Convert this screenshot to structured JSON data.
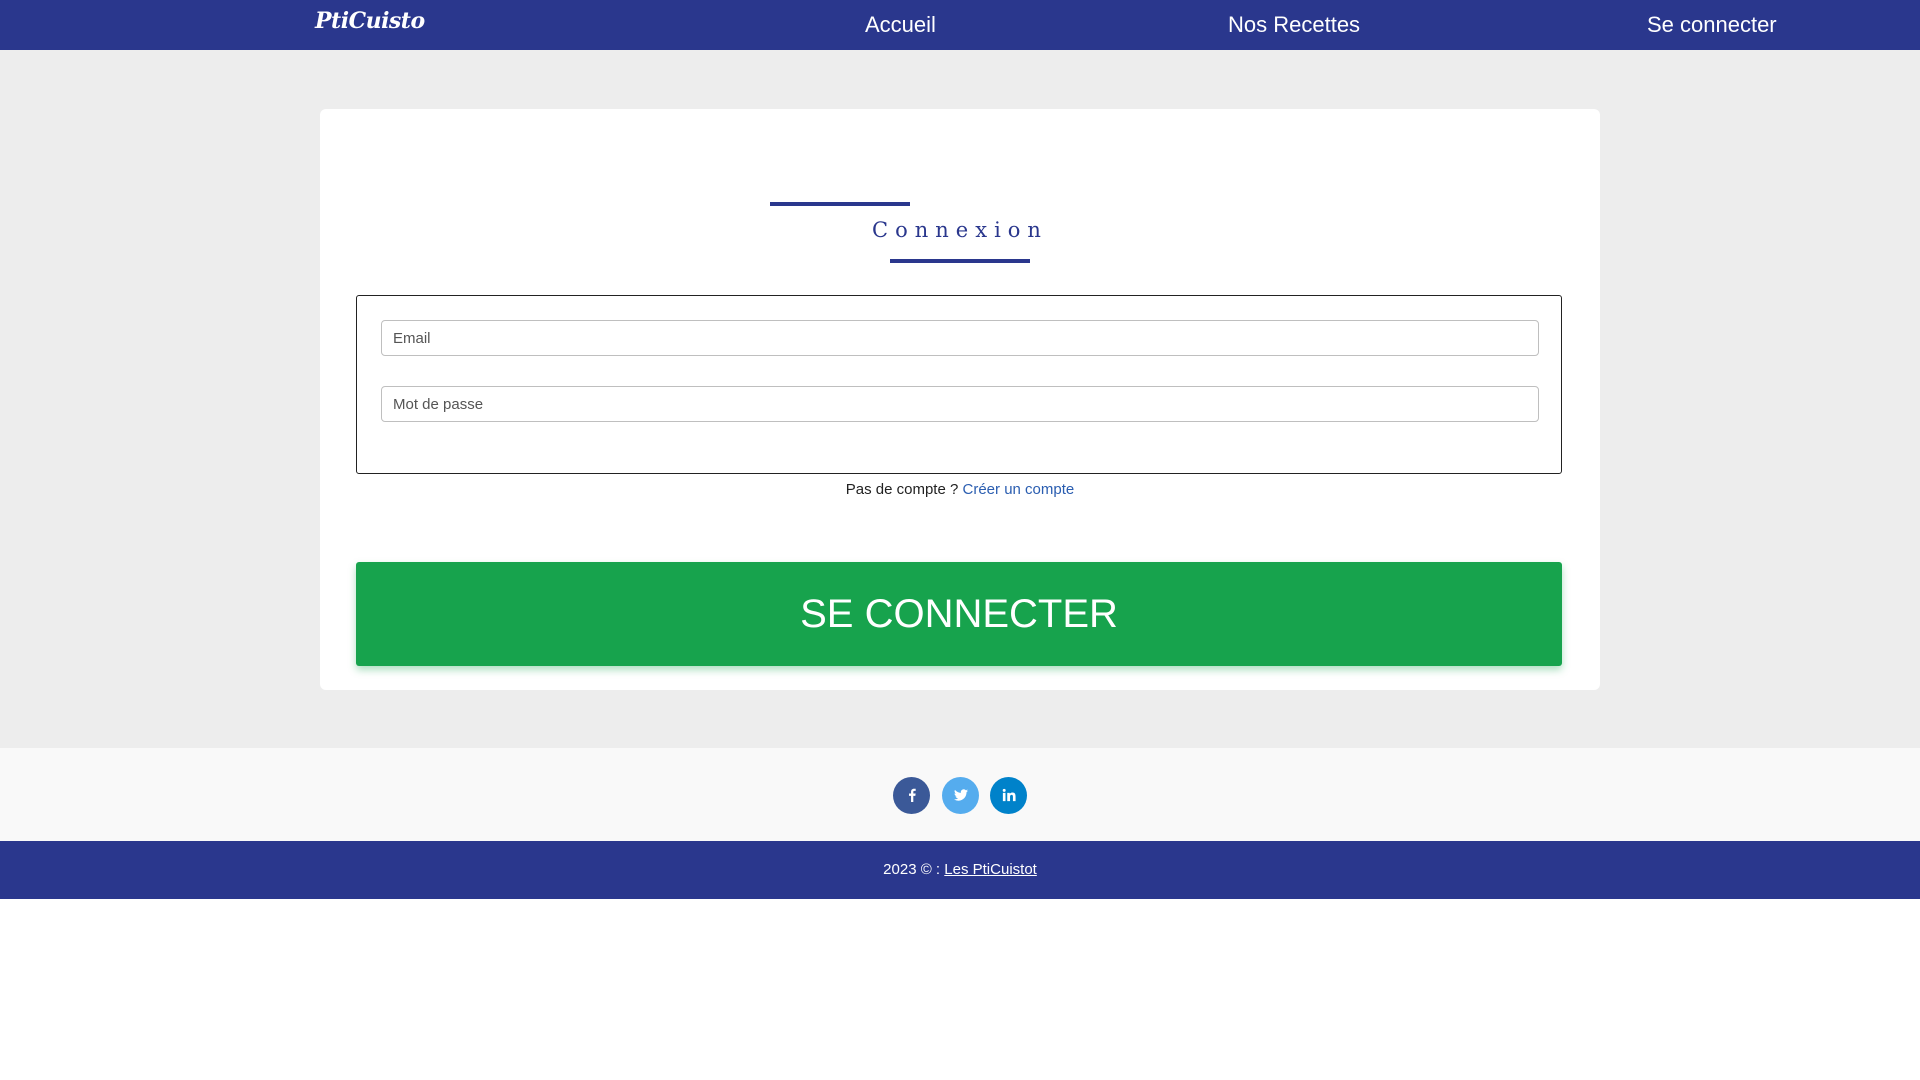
{
  "nav": {
    "brand": "PtiCuisto",
    "links": [
      "Accueil",
      "Nos Recettes",
      "Se connecter"
    ]
  },
  "login": {
    "title": "Connexion",
    "email_placeholder": "Email",
    "password_placeholder": "Mot de passe",
    "signup_prompt": "Pas de compte ?",
    "signup_link": "Créer un compte",
    "submit_label": "SE CONNECTER"
  },
  "footer": {
    "social": [
      {
        "icon": "facebook-icon",
        "color": "#3b5998"
      },
      {
        "icon": "twitter-icon",
        "color": "#55acee"
      },
      {
        "icon": "linkedin-icon",
        "color": "#0082ca"
      }
    ],
    "copyright_prefix": "2023 © :",
    "copyright_link": "Les PtiCuistot"
  },
  "colors": {
    "primary": "#2a378d",
    "success": "#17a34d",
    "page_background": "#ededed"
  }
}
